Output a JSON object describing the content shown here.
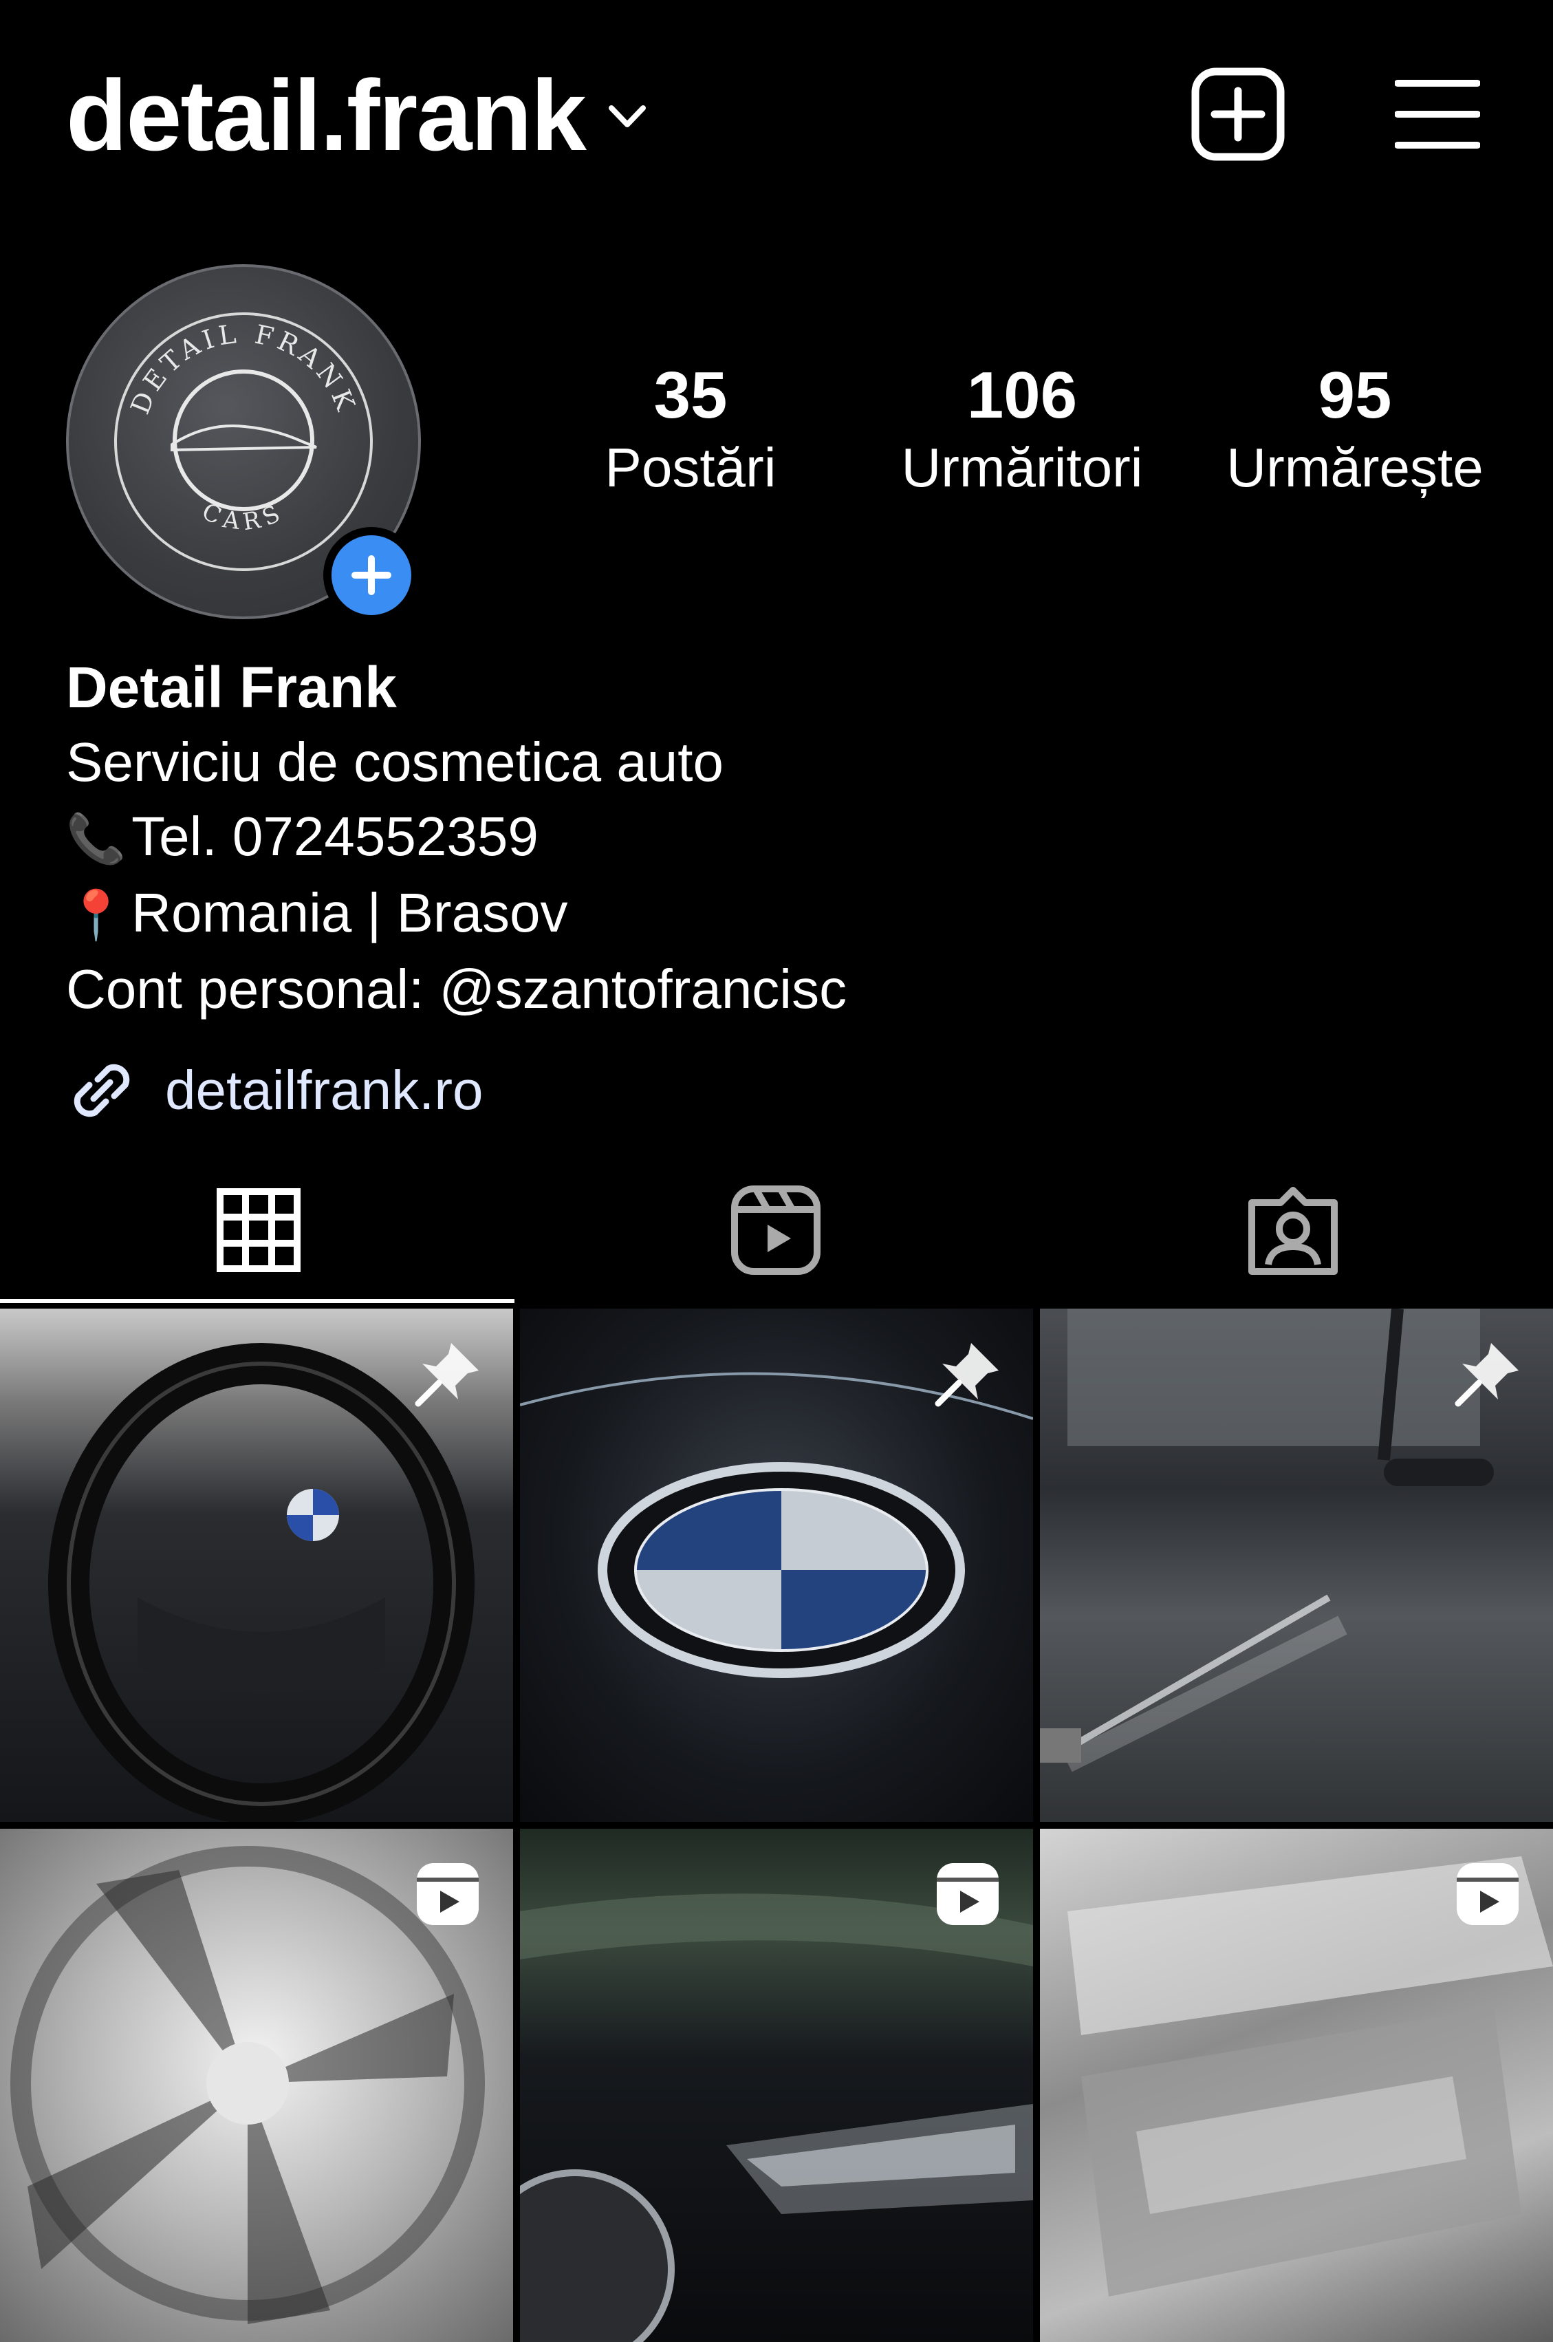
{
  "header": {
    "username": "detail.frank"
  },
  "profile": {
    "avatar_text_top": "DETAIL FRANK",
    "avatar_text_bottom": "CARS",
    "stats": [
      {
        "value": "35",
        "label": "Postări"
      },
      {
        "value": "106",
        "label": "Urmăritori"
      },
      {
        "value": "95",
        "label": "Urmărește"
      }
    ],
    "display_name": "Detail Frank",
    "bio_lines": [
      {
        "emoji": "",
        "text": "Serviciu de cosmetica auto"
      },
      {
        "emoji": "📞",
        "text": "Tel. 0724552359"
      },
      {
        "emoji": "📍",
        "text": "Romania | Brasov"
      },
      {
        "emoji": "",
        "text": "Cont personal: @szantofrancisc"
      }
    ],
    "website": "detailfrank.ro"
  },
  "tabs": [
    {
      "name": "posts-grid",
      "icon": "grid-icon",
      "active": true
    },
    {
      "name": "reels",
      "icon": "reels-icon",
      "active": false
    },
    {
      "name": "tagged",
      "icon": "tagged-icon",
      "active": false
    }
  ],
  "posts": [
    {
      "subject": "steering wheel",
      "badge": "pin-icon"
    },
    {
      "subject": "BMW emblem",
      "badge": "pin-icon"
    },
    {
      "subject": "car door washing",
      "badge": "pin-icon"
    },
    {
      "subject": "foamed wheel rim",
      "badge": "reel-icon"
    },
    {
      "subject": "car front headlight",
      "badge": "reel-icon"
    },
    {
      "subject": "foamed engine bay",
      "badge": "reel-icon"
    }
  ],
  "colors": {
    "background": "#000000",
    "text": "#ffffff",
    "accent_blue": "#3a8ef3"
  }
}
